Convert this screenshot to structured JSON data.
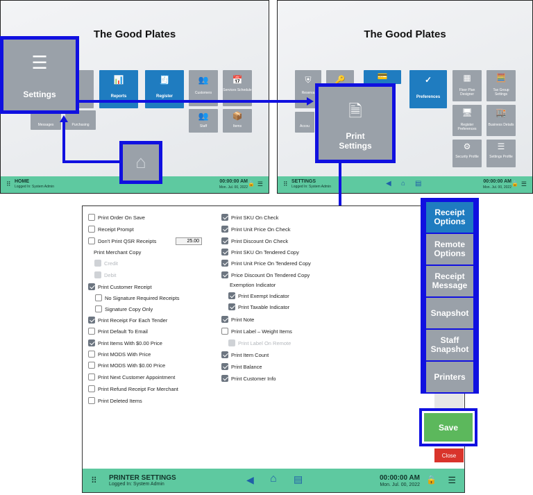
{
  "app": {
    "title": "The Good Plates"
  },
  "home_screen": {
    "footer": {
      "title": "HOME",
      "sub": "Logged In:  System Admin",
      "time": "00:00:00 AM",
      "date": "Mon. Jul. 00, 2022"
    },
    "tiles": [
      {
        "id": "customers",
        "label": "Customers",
        "icon": "people-icon"
      },
      {
        "id": "services",
        "label": "Services Schedule",
        "icon": "calendar-icon"
      },
      {
        "id": "reports",
        "label": "Reports",
        "icon": "report-icon"
      },
      {
        "id": "register",
        "label": "Register",
        "icon": "register-icon"
      },
      {
        "id": "messages",
        "label": "Messages",
        "icon": "message-icon"
      },
      {
        "id": "purchasing",
        "label": "Purchasing",
        "icon": "cart-icon"
      },
      {
        "id": "staff",
        "label": "Staff",
        "icon": "staff-icon"
      },
      {
        "id": "items",
        "label": "Items",
        "icon": "box-icon"
      }
    ],
    "settings_callout": {
      "label": "Settings",
      "icon": "sliders-icon"
    },
    "home_button": {
      "icon": "home-icon"
    }
  },
  "settings_screen": {
    "footer": {
      "title": "SETTINGS",
      "sub": "Logged In:  System Admin",
      "time": "00:00:00 AM",
      "date": "Mon. Jul. 00, 2022"
    },
    "tiles": [
      {
        "id": "preferences",
        "label": "Preferences",
        "icon": "check-circle-icon"
      },
      {
        "id": "floorplan",
        "label": "Floor Plan Designer",
        "icon": "floorplan-icon"
      },
      {
        "id": "taxgroup",
        "label": "Tax Group Settings",
        "icon": "tax-icon"
      },
      {
        "id": "regpref",
        "label": "Register Preferences",
        "icon": "register-icon"
      },
      {
        "id": "business",
        "label": "Business Details",
        "icon": "store-icon"
      },
      {
        "id": "security",
        "label": "Security Profile",
        "icon": "shield-icon"
      },
      {
        "id": "settingsprofile",
        "label": "Settings Profile",
        "icon": "sliders-icon"
      },
      {
        "id": "reserv",
        "label": "Reserva",
        "icon": "shield-icon"
      },
      {
        "id": "accou",
        "label": "Accou",
        "icon": "card-icon"
      }
    ],
    "print_callout": {
      "label_line1": "Print",
      "label_line2": "Settings",
      "icon": "receipt-icon"
    }
  },
  "printer_settings": {
    "footer": {
      "title": "PRINTER SETTINGS",
      "sub": "Logged In:  System Admin",
      "time": "00:00:00 AM",
      "date": "Mon. Jul. 00, 2022"
    },
    "qsr_value": "25.00",
    "left_col": [
      {
        "label": "Print Order On Save",
        "state": "off"
      },
      {
        "label": "Receipt Prompt",
        "state": "off"
      },
      {
        "label": "Don't Print QSR Receipts",
        "state": "off"
      },
      {
        "label": "Print Merchant Copy",
        "state": "none"
      },
      {
        "label": "Credit",
        "state": "disabled"
      },
      {
        "label": "Debit",
        "state": "disabled"
      },
      {
        "label": "Print Customer Receipt",
        "state": "on"
      },
      {
        "label": "No Signature Required Receipts",
        "state": "off"
      },
      {
        "label": "Signature Copy Only",
        "state": "off"
      },
      {
        "label": "Print Receipt For Each Tender",
        "state": "on"
      },
      {
        "label": "Print Default To Email",
        "state": "off"
      },
      {
        "label": "Print Items With $0.00 Price",
        "state": "on"
      },
      {
        "label": "Print MODS With Price",
        "state": "off"
      },
      {
        "label": "Print MODS With $0.00 Price",
        "state": "off"
      },
      {
        "label": "Print Next Customer Appointment",
        "state": "off"
      },
      {
        "label": "Print Refund Receipt For Merchant",
        "state": "off"
      },
      {
        "label": "Print Deleted Items",
        "state": "off"
      }
    ],
    "right_col": [
      {
        "label": "Print SKU On Check",
        "state": "on"
      },
      {
        "label": "Print Unit Price On Check",
        "state": "on"
      },
      {
        "label": "Print Discount On Check",
        "state": "on"
      },
      {
        "label": "Print SKU On Tendered Copy",
        "state": "on"
      },
      {
        "label": "Print Unit Price On Tendered Copy",
        "state": "on"
      },
      {
        "label": "Price Discount On Tendered Copy",
        "state": "on"
      },
      {
        "label": "Exemption Indicator",
        "state": "none"
      },
      {
        "label": "Print Exempt Indicator",
        "state": "on"
      },
      {
        "label": "Print Taxable Indicator",
        "state": "on"
      },
      {
        "label": "Print Note",
        "state": "on"
      },
      {
        "label": "Print Label – Weight Items",
        "state": "off"
      },
      {
        "label": "Print Label On Remote",
        "state": "disabled"
      },
      {
        "label": "Print Item Count",
        "state": "on"
      },
      {
        "label": "Print Balance",
        "state": "on"
      },
      {
        "label": "Print Customer Info",
        "state": "on"
      }
    ],
    "side_buttons": [
      {
        "line1": "Receipt",
        "line2": "Options",
        "active": true
      },
      {
        "line1": "Remote",
        "line2": "Options",
        "active": false
      },
      {
        "line1": "Receipt",
        "line2": "Message",
        "active": false
      },
      {
        "line1": "Snapshot",
        "line2": "",
        "active": false
      },
      {
        "line1": "Staff",
        "line2": "Snapshot",
        "active": false
      },
      {
        "line1": "Printers",
        "line2": "",
        "active": false
      }
    ],
    "save_label": "Save",
    "close_label": "Close"
  },
  "colors": {
    "accent_blue": "#1f7cc0",
    "callout_blue": "#1010e0",
    "footer_green": "#5ec9a0",
    "save_green": "#5cb85c",
    "close_red": "#d9342b"
  }
}
